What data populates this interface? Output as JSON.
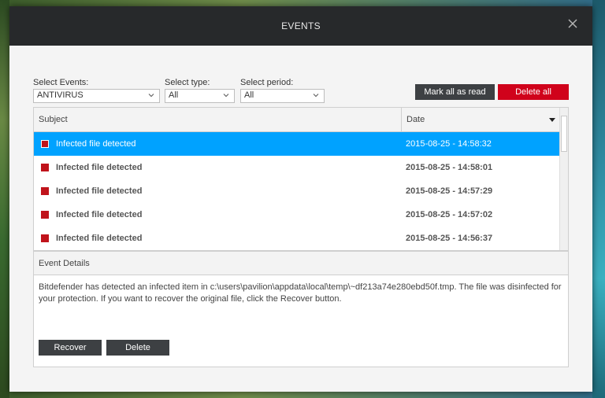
{
  "dialog": {
    "title": "EVENTS"
  },
  "filters": {
    "events": {
      "label": "Select Events:",
      "value": "ANTIVIRUS"
    },
    "type": {
      "label": "Select type:",
      "value": "All"
    },
    "period": {
      "label": "Select period:",
      "value": "All"
    }
  },
  "actions": {
    "mark_all_read": "Mark all as read",
    "delete_all": "Delete all"
  },
  "table": {
    "columns": [
      "Subject",
      "Date"
    ],
    "rows": [
      {
        "subject": "Infected file detected",
        "date": "2015-08-25 - 14:58:32"
      },
      {
        "subject": "Infected file detected",
        "date": "2015-08-25 - 14:58:01"
      },
      {
        "subject": "Infected file detected",
        "date": "2015-08-25 - 14:57:29"
      },
      {
        "subject": "Infected file detected",
        "date": "2015-08-25 - 14:57:02"
      },
      {
        "subject": "Infected file detected",
        "date": "2015-08-25 - 14:56:37"
      }
    ]
  },
  "details": {
    "header": "Event Details",
    "text": "Bitdefender has detected an infected item in c:\\users\\pavilion\\appdata\\local\\temp\\~df213a74e280ebd50f.tmp. The file was disinfected for your protection. If you want to recover the original file, click the Recover button.",
    "recover_label": "Recover",
    "delete_label": "Delete"
  },
  "colors": {
    "accent": "#00a2ff",
    "danger": "#d0021b",
    "titlebar": "#27292b",
    "button": "#3d4043"
  }
}
